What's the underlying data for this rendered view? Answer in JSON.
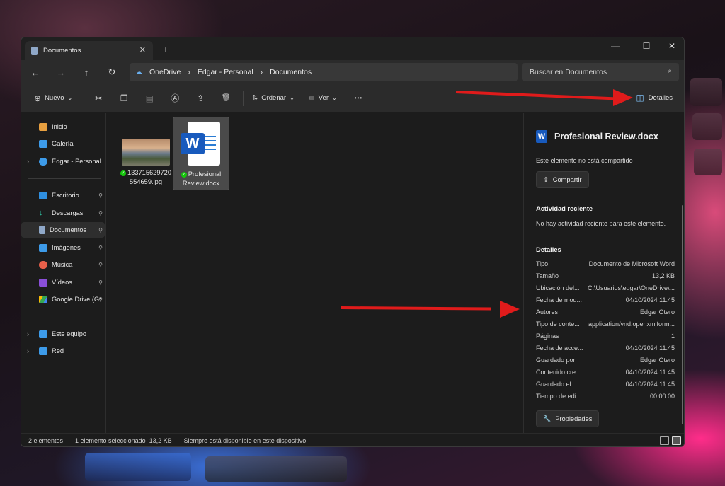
{
  "window": {
    "tab_title": "Documentos",
    "tab_close": "✕",
    "new_tab": "+",
    "controls": {
      "minimize": "—",
      "maximize": "☐",
      "close": "✕"
    }
  },
  "nav": {
    "back_icon": "←",
    "forward_icon": "→",
    "up_icon": "↑",
    "refresh_icon": "↻",
    "breadcrumb": [
      "OneDrive",
      "Edgar - Personal",
      "Documentos"
    ],
    "breadcrumb_sep": "›",
    "search_placeholder": "Buscar en Documentos",
    "search_icon": "⌕"
  },
  "toolbar": {
    "new_label": "Nuevo",
    "sort_label": "Ordenar",
    "view_label": "Ver",
    "more_label": "•••",
    "details_label": "Detalles",
    "icons": {
      "new": "⊕",
      "cut": "✂",
      "copy": "❐",
      "paste": "▤",
      "rename": "Ⓐ",
      "share": "⇪",
      "delete": "🗑",
      "sort": "⇅",
      "view": "▭",
      "dropdown": "⌄",
      "details": "◫"
    }
  },
  "sidebar": {
    "chevron": "›",
    "pin": "📌",
    "items": [
      {
        "label": "Inicio",
        "color": "#e8a040"
      },
      {
        "label": "Galería",
        "color": "#3d9be9"
      },
      {
        "label": "Edgar - Personal",
        "color": "#3d9be9"
      },
      {
        "label": "Escritorio",
        "color": "#2f8fe0"
      },
      {
        "label": "Descargas",
        "color": "#2fbf9f"
      },
      {
        "label": "Documentos",
        "color": "#8fa8c8"
      },
      {
        "label": "Imágenes",
        "color": "#3d9be9"
      },
      {
        "label": "Música",
        "color": "#e8604a"
      },
      {
        "label": "Vídeos",
        "color": "#8a4fd8"
      },
      {
        "label": "Google Drive (G:",
        "color": "#34a853"
      },
      {
        "label": "Este equipo",
        "color": "#3d9be9"
      },
      {
        "label": "Red",
        "color": "#3d9be9"
      }
    ]
  },
  "files": [
    {
      "name_line1": "133715629720",
      "name_line2": "554659.jpg",
      "synced_icon": "✓"
    },
    {
      "name_line1": "Profesional",
      "name_line2": "Review.docx",
      "synced_icon": "✓",
      "word_letter": "W"
    }
  ],
  "details": {
    "file_title": "Profesional Review.docx",
    "word_icon_letter": "W",
    "share_status": "Este elemento no está compartido",
    "share_button": "Compartir",
    "share_icon": "⇪",
    "activity_heading": "Actividad reciente",
    "activity_text": "No hay actividad reciente para este elemento.",
    "details_heading": "Detalles",
    "properties": [
      {
        "k": "Tipo",
        "v": "Documento de Microsoft Word"
      },
      {
        "k": "Tamaño",
        "v": "13,2 KB"
      },
      {
        "k": "Ubicación del...",
        "v": "C:\\Usuarios\\edgar\\OneDrive\\..."
      },
      {
        "k": "Fecha de mod...",
        "v": "04/10/2024 11:45"
      },
      {
        "k": "Autores",
        "v": "Edgar Otero"
      },
      {
        "k": "Tipo de conte...",
        "v": "application/vnd.openxmlform..."
      },
      {
        "k": "Páginas",
        "v": "1"
      },
      {
        "k": "Fecha de acce...",
        "v": "04/10/2024 11:45"
      },
      {
        "k": "Guardado por",
        "v": "Edgar Otero"
      },
      {
        "k": "Contenido cre...",
        "v": "04/10/2024 11:45"
      },
      {
        "k": "Guardado el",
        "v": "04/10/2024 11:45"
      },
      {
        "k": "Tiempo de edi...",
        "v": "00:00:00"
      }
    ],
    "properties_button": "Propiedades",
    "properties_icon": "🔧"
  },
  "status": {
    "count": "2 elementos",
    "selected": "1 elemento seleccionado  13,2 KB",
    "availability": "Siempre está disponible en este dispositivo"
  },
  "annotation_color": "#e01b1b"
}
